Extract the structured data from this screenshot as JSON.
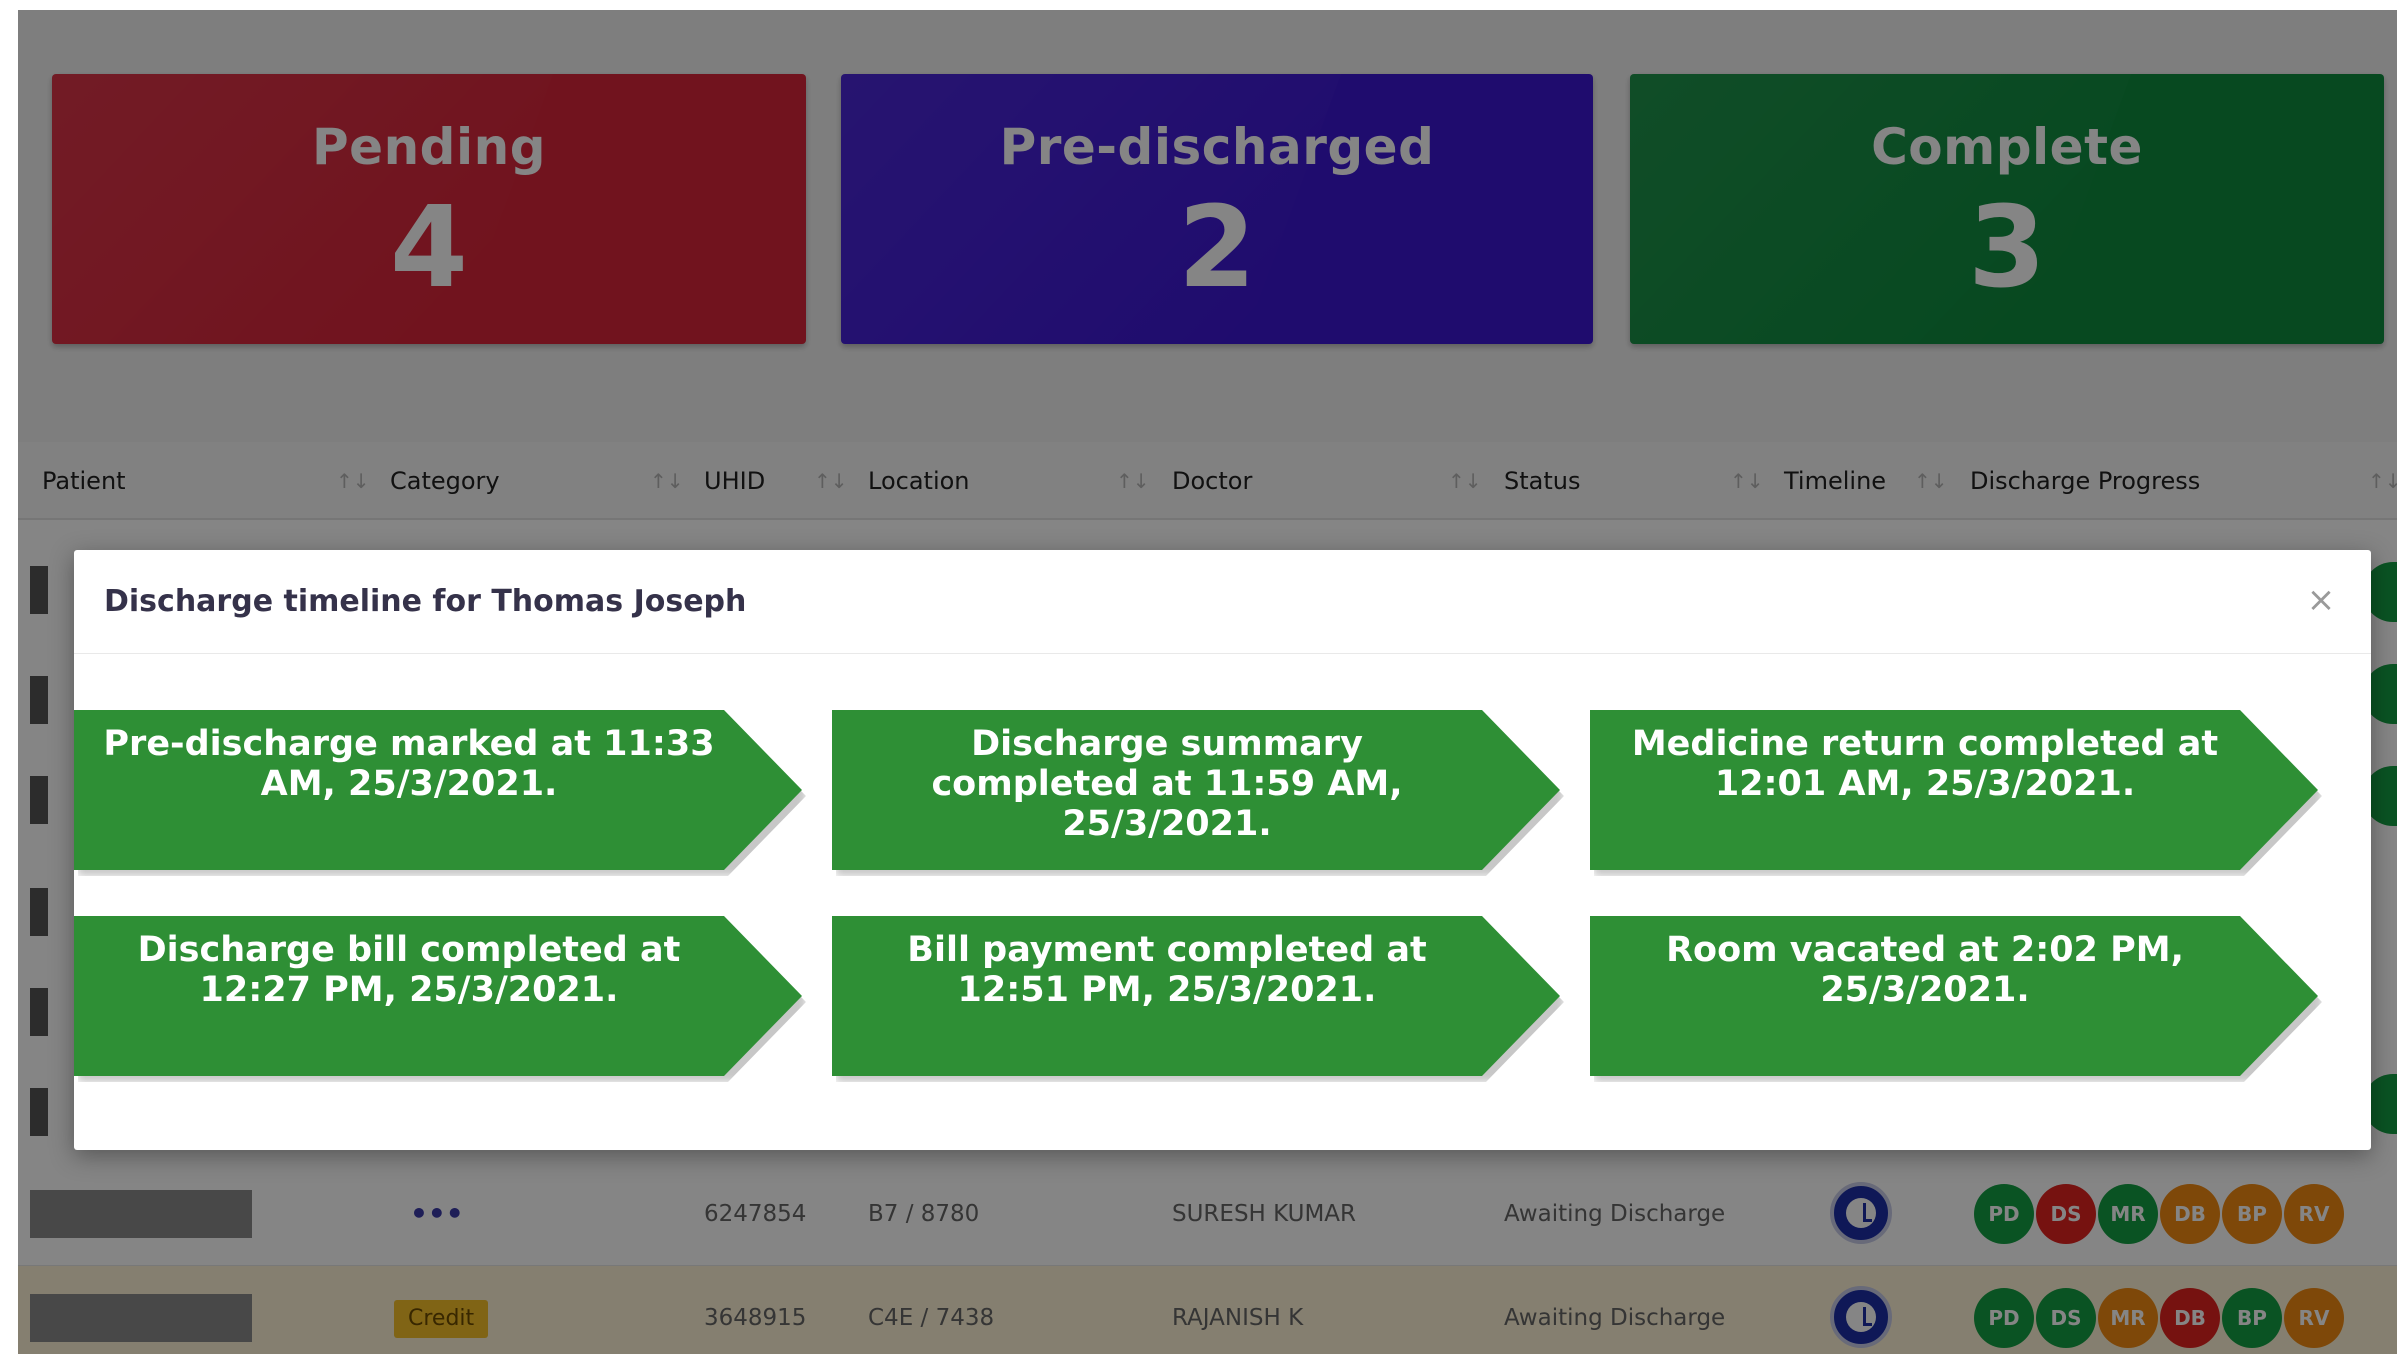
{
  "stats": {
    "pending": {
      "label": "Pending",
      "count": "4"
    },
    "pre_discharged": {
      "label": "Pre-discharged",
      "count": "2"
    },
    "complete": {
      "label": "Complete",
      "count": "3"
    }
  },
  "table": {
    "columns": [
      "Patient",
      "Category",
      "UHID",
      "Location",
      "Doctor",
      "Status",
      "Timeline",
      "Discharge Progress"
    ],
    "rows": [
      {
        "category": "•••",
        "uhid": "6247854",
        "location": "B7 / 8780",
        "doctor": "SURESH KUMAR",
        "status": "Awaiting Discharge",
        "progress": [
          {
            "code": "PD",
            "color": "green"
          },
          {
            "code": "DS",
            "color": "red"
          },
          {
            "code": "MR",
            "color": "green"
          },
          {
            "code": "DB",
            "color": "orange"
          },
          {
            "code": "BP",
            "color": "orange"
          },
          {
            "code": "RV",
            "color": "orange"
          }
        ]
      },
      {
        "category": "Credit",
        "uhid": "3648915",
        "location": "C4E / 7438",
        "doctor": "RAJANISH K",
        "status": "Awaiting Discharge",
        "progress": [
          {
            "code": "PD",
            "color": "green"
          },
          {
            "code": "DS",
            "color": "green"
          },
          {
            "code": "MR",
            "color": "orange"
          },
          {
            "code": "DB",
            "color": "red"
          },
          {
            "code": "BP",
            "color": "green"
          },
          {
            "code": "RV",
            "color": "orange"
          }
        ]
      }
    ]
  },
  "modal": {
    "title": "Discharge timeline for Thomas Joseph",
    "close_symbol": "×",
    "steps": [
      [
        "Pre-discharge marked at 11:33",
        "AM, 25/3/2021."
      ],
      [
        "Discharge summary",
        "completed at 11:59 AM,",
        "25/3/2021."
      ],
      [
        "Medicine return completed at",
        "12:01 AM, 25/3/2021."
      ],
      [
        "Discharge bill completed at",
        "12:27 PM, 25/3/2021."
      ],
      [
        "Bill payment completed at",
        "12:51 PM, 25/3/2021."
      ],
      [
        "Room vacated at 2:02 PM,",
        "25/3/2021."
      ]
    ]
  },
  "colors": {
    "pending": "#d8253a",
    "pre_discharged": "#3d17d4",
    "complete": "#0e8c3e",
    "step": "#2e8f35"
  },
  "icons": {
    "timeline": "clock-icon",
    "close": "close-icon",
    "sort": "sort-icon"
  }
}
